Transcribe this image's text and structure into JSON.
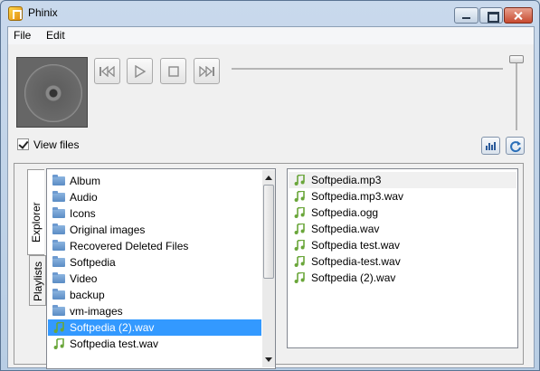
{
  "window": {
    "title": "Phinix"
  },
  "menu": [
    "File",
    "Edit"
  ],
  "view_files": {
    "label": "View files",
    "checked": true
  },
  "tabs": [
    "Explorer",
    "Playlists"
  ],
  "folders": [
    {
      "name": "Album",
      "type": "folder"
    },
    {
      "name": "Audio",
      "type": "folder"
    },
    {
      "name": "Icons",
      "type": "folder"
    },
    {
      "name": "Original images",
      "type": "folder"
    },
    {
      "name": "Recovered Deleted Files",
      "type": "folder"
    },
    {
      "name": "Softpedia",
      "type": "folder"
    },
    {
      "name": "Video",
      "type": "folder"
    },
    {
      "name": "backup",
      "type": "folder"
    },
    {
      "name": "vm-images",
      "type": "folder"
    },
    {
      "name": "Softpedia (2).wav",
      "type": "audio",
      "selected": true
    },
    {
      "name": "Softpedia test.wav",
      "type": "audio"
    }
  ],
  "files": [
    "Softpedia.mp3",
    "Softpedia.mp3.wav",
    "Softpedia.ogg",
    "Softpedia.wav",
    "Softpedia test.wav",
    "Softpedia-test.wav",
    "Softpedia (2).wav"
  ],
  "controls": [
    "previous-icon",
    "play-icon",
    "stop-icon",
    "next-icon"
  ],
  "colors": {
    "selection": "#3399ff",
    "note_icon": "#6aa63a"
  }
}
